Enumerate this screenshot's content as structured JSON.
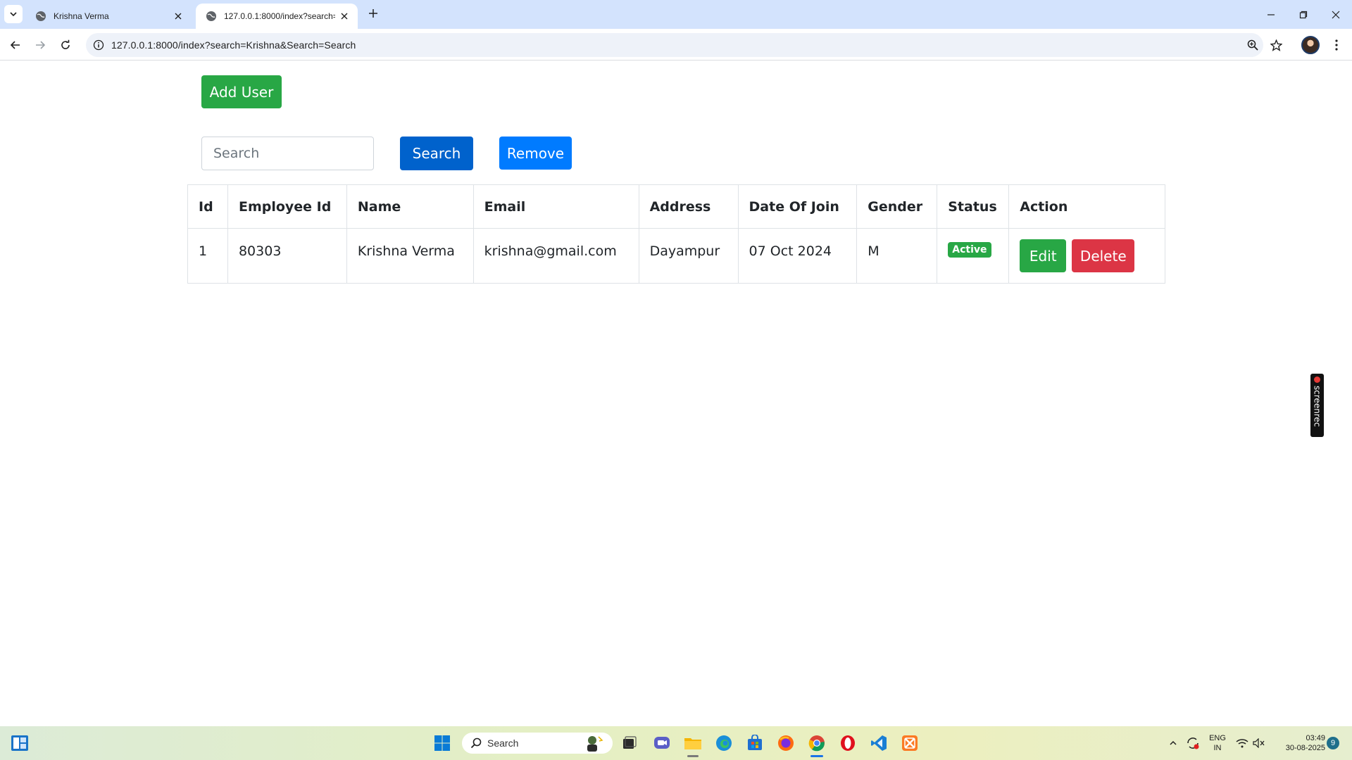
{
  "browser": {
    "tabs": [
      {
        "title": "Krishna Verma",
        "active": false
      },
      {
        "title": "127.0.0.1:8000/index?search=Kri",
        "active": true
      }
    ],
    "url": "127.0.0.1:8000/index?search=Krishna&Search=Search"
  },
  "page": {
    "add_user_label": "Add User",
    "search": {
      "placeholder": "Search",
      "value": ""
    },
    "search_button_label": "Search",
    "remove_button_label": "Remove",
    "table": {
      "columns": [
        "Id",
        "Employee Id",
        "Name",
        "Email",
        "Address",
        "Date Of Join",
        "Gender",
        "Status",
        "Action"
      ],
      "rows": [
        {
          "id": "1",
          "employee_id": "80303",
          "name": "Krishna Verma",
          "email": "krishna@gmail.com",
          "address": "Dayampur",
          "date_of_join": "07 Oct 2024",
          "gender": "M",
          "status": "Active",
          "edit_label": "Edit",
          "delete_label": "Delete"
        }
      ]
    }
  },
  "overlay": {
    "screenrec_label": "screenrec"
  },
  "taskbar": {
    "search_placeholder": "Search",
    "lang_line1": "ENG",
    "lang_line2": "IN",
    "time": "03:49",
    "date": "30-08-2025",
    "notification_count": "9"
  },
  "colors": {
    "success": "#28a745",
    "primary": "#007bff",
    "primary_dark": "#0062cc",
    "danger": "#dc3545",
    "tabstrip": "#d3e3fd"
  }
}
